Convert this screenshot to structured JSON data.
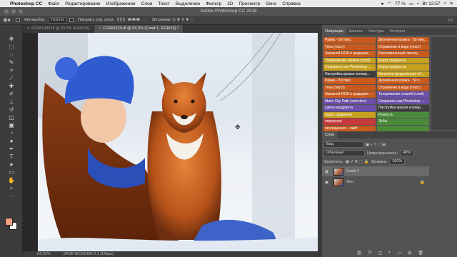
{
  "menubar": {
    "app_name": "Photoshop CC",
    "items": [
      "Файл",
      "Редактирование",
      "Изображение",
      "Слои",
      "Текст",
      "Выделение",
      "Фильтр",
      "3D",
      "Просмотр",
      "Окно",
      "Справка"
    ],
    "battery": "77 %",
    "clock": "Вт 12:57"
  },
  "window": {
    "title": "Adobe Photoshop CC 2018"
  },
  "options": {
    "autoselect_label": "Автовыбор:",
    "autoselect_value": "Группа",
    "show_controls_label": "Показать упр. элем."
  },
  "tabs": [
    {
      "label": "FC6A1483.tif @ 33,3% (RGB/16)"
    },
    {
      "label": "FC6A1529.tif @ 54,3% (Слой 1, RGB/16) *"
    }
  ],
  "status": {
    "zoom": "54,32%",
    "profile": "sRGB IEC61966-2.1 (16bpc)"
  },
  "panel_tabs": [
    "Операции",
    "Каналы",
    "Контуры",
    "История"
  ],
  "actions": [
    {
      "label": "Рамка - 50 пикс.",
      "color": "#c85a1e"
    },
    {
      "label": "Деревянная рамка - 50 пикс.",
      "color": "#c85a1e"
    },
    {
      "label": "Тень (текст)",
      "color": "#c85a1e"
    },
    {
      "label": "Отражение в воде (текст)",
      "color": "#c85a1e"
    },
    {
      "label": "Заказной RGB в градации ...",
      "color": "#c85a1e"
    },
    {
      "label": "Расплавленный свинец",
      "color": "#c85a1e"
    },
    {
      "label": "Тонирование сепией (слой)",
      "color": "#c8a020"
    },
    {
      "label": "Карта градиента",
      "color": "#c8a020"
    },
    {
      "label": "Сохранить как Photoshop ...",
      "color": "#c8a020"
    },
    {
      "label": "Карта градиента",
      "color": "#c8a020"
    },
    {
      "label": "Настройка краски клонир...",
      "color": "#3d3d3d"
    },
    {
      "label": "Виньетка (выделенная об...",
      "color": "#c8a020"
    },
    {
      "label": "Рамка - 50 пикс.",
      "color": "#c85a1e"
    },
    {
      "label": "Деревянная рамка - 50 п...",
      "color": "#c85a1e"
    },
    {
      "label": "Тень (текст)",
      "color": "#c85a1e"
    },
    {
      "label": "Отражение в воде (текст)",
      "color": "#c85a1e"
    },
    {
      "label": "Заказной RGB в градации ...",
      "color": "#c85a1e"
    },
    {
      "label": "Тонирование сепией (слой)",
      "color": "#6b4fa8"
    },
    {
      "label": "Make City Path (selection)",
      "color": "#6b4fa8"
    },
    {
      "label": "Сохранить как Photoshop ...",
      "color": "#6b4fa8"
    },
    {
      "label": "Цвета квадранта",
      "color": "#6b4fa8"
    },
    {
      "label": "Настройка краски клонир...",
      "color": "#3d3d3d"
    },
    {
      "label": "Карта градиента",
      "color": "#c8a020"
    },
    {
      "label": "Резкость",
      "color": "#4a8a3a"
    },
    {
      "label": "портретра",
      "color": "#c83a3a"
    },
    {
      "label": "Зубы",
      "color": "#4a8a3a"
    },
    {
      "label": "несоединено - лайт",
      "color": "#c85a1e"
    },
    {
      "label": "",
      "color": "#4a8a3a"
    }
  ],
  "layers_panel": {
    "tab": "Слои",
    "filter_value": "Вид",
    "blend_mode": "Обычные",
    "opacity_label": "Непрозрачность:",
    "opacity_value": "49%",
    "lock_label": "Закрепить:",
    "fill_label": "Заливка:",
    "fill_value": "100%",
    "layers": [
      {
        "name": "Слой 1"
      },
      {
        "name": "Фон"
      }
    ]
  },
  "colors": {
    "fg": "#f0a080",
    "bg": "#ffffff"
  }
}
